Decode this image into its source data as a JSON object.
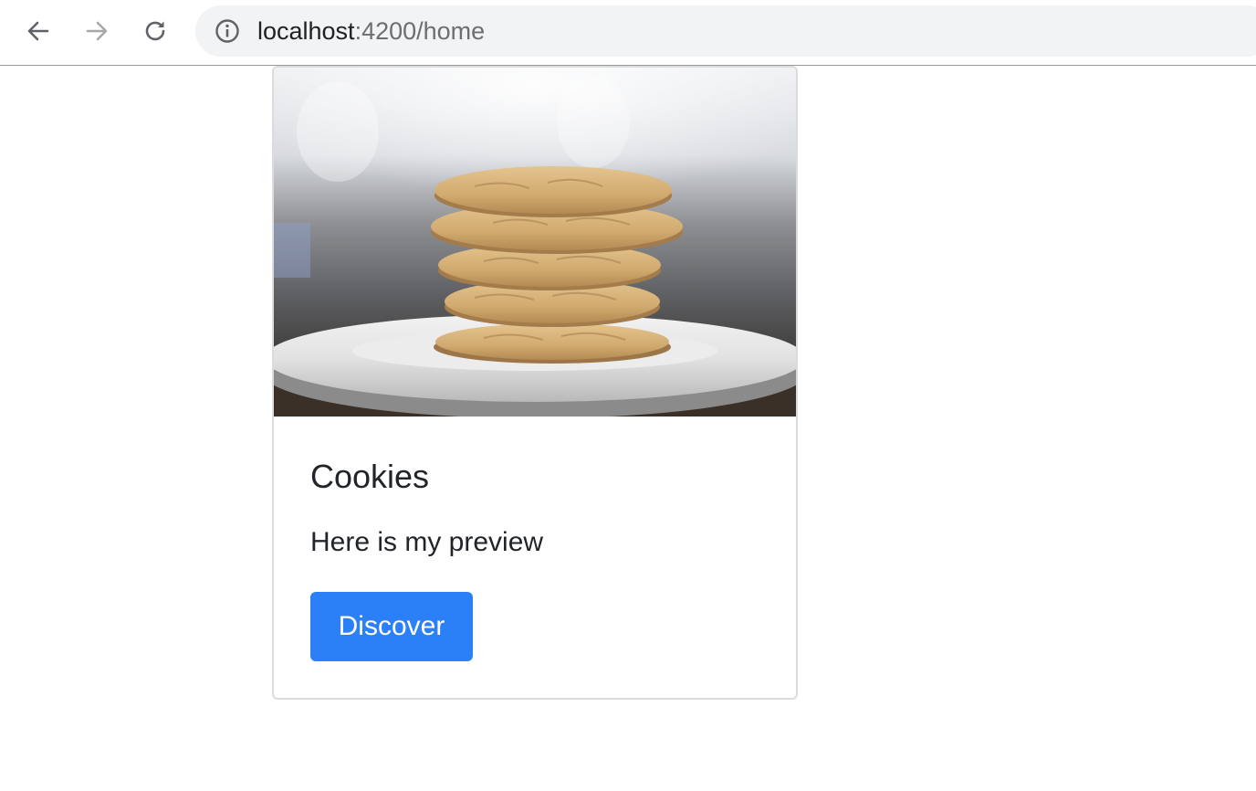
{
  "browser": {
    "url_host": "localhost",
    "url_path": ":4200/home",
    "icons": {
      "back": "arrow-left-icon",
      "forward": "arrow-right-icon",
      "reload": "reload-icon",
      "site_info": "info-icon"
    },
    "colors": {
      "omnibox_bg": "#f1f3f4",
      "icon_active": "#5f6368",
      "icon_disabled": "#a8a8a8"
    }
  },
  "card": {
    "title": "Cookies",
    "text": "Here is my preview",
    "button_label": "Discover",
    "colors": {
      "button_bg": "#2b7ff7",
      "button_text": "#ffffff",
      "border": "#dcdcdc"
    }
  }
}
